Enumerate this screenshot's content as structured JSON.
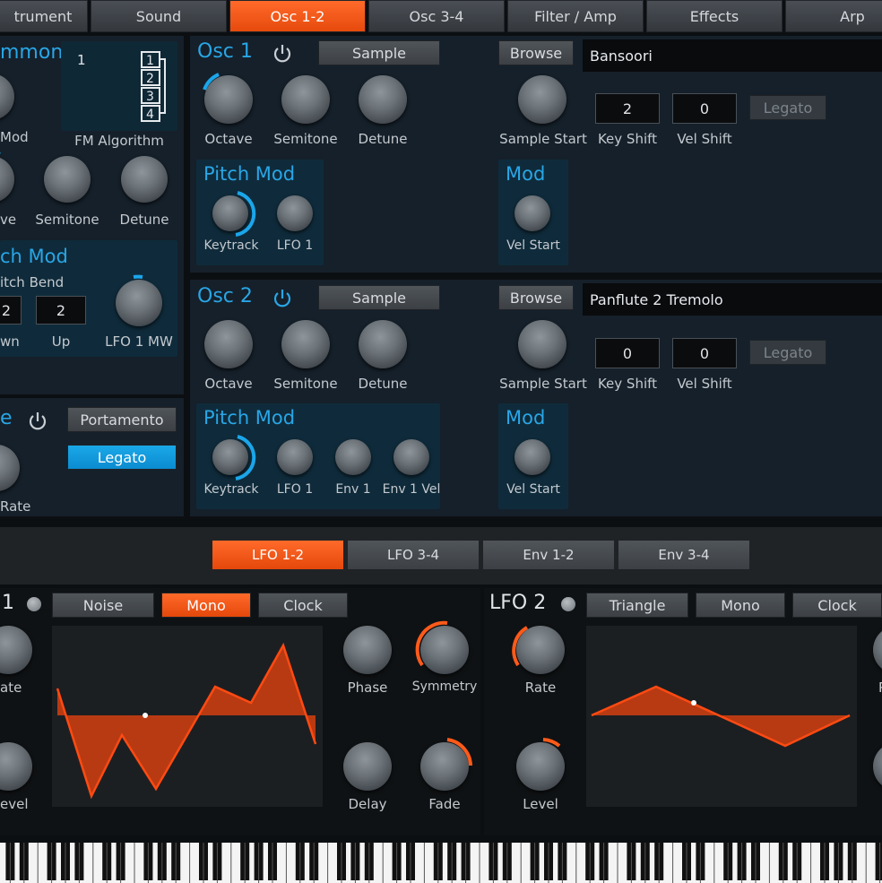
{
  "top_tabs": [
    {
      "label": "trument"
    },
    {
      "label": "Sound"
    },
    {
      "label": "Osc 1-2"
    },
    {
      "label": "Osc 3-4"
    },
    {
      "label": "Filter / Amp"
    },
    {
      "label": "Effects"
    },
    {
      "label": "Arp"
    }
  ],
  "common": {
    "title": "mmon",
    "algo_numbers": [
      "1",
      "2",
      "3",
      "4"
    ],
    "algo_selected": "1",
    "fm_algorithm": "FM Algorithm",
    "mod": "Mod",
    "octave": "ve",
    "semitone": "Semitone",
    "detune": "Detune",
    "pitch_mod": "ch Mod",
    "pitch_bend": "itch Bend",
    "down_value": "2",
    "up_value": "2",
    "down": "wn",
    "up": "Up",
    "lfo1mw": "LFO 1 MW"
  },
  "glide": {
    "title": "e",
    "portamento": "Portamento",
    "legato": "Legato",
    "rate": "Rate"
  },
  "osc1": {
    "title": "Osc 1",
    "sample": "Sample",
    "octave": "Octave",
    "semitone": "Semitone",
    "detune": "Detune",
    "pitch_mod": "Pitch Mod",
    "keytrack": "Keytrack",
    "lfo1": "LFO 1",
    "browse": "Browse",
    "sample_name": "Bansoori",
    "sample_start": "Sample Start",
    "key_shift": "Key Shift",
    "vel_shift": "Vel Shift",
    "key_shift_value": "2",
    "vel_shift_value": "0",
    "legato": "Legato",
    "mod": "Mod",
    "vel_start": "Vel Start"
  },
  "osc2": {
    "title": "Osc 2",
    "sample": "Sample",
    "octave": "Octave",
    "semitone": "Semitone",
    "detune": "Detune",
    "pitch_mod": "Pitch Mod",
    "keytrack": "Keytrack",
    "lfo1": "LFO 1",
    "env1": "Env 1",
    "env1vel": "Env 1 Vel",
    "browse": "Browse",
    "sample_name": "Panflute 2 Tremolo",
    "sample_start": "Sample Start",
    "key_shift": "Key Shift",
    "vel_shift": "Vel Shift",
    "key_shift_value": "0",
    "vel_shift_value": "0",
    "legato": "Legato",
    "mod": "Mod",
    "vel_start": "Vel Start"
  },
  "bottom_tabs": [
    {
      "label": "LFO 1-2"
    },
    {
      "label": "LFO 3-4"
    },
    {
      "label": "Env 1-2"
    },
    {
      "label": "Env 3-4"
    }
  ],
  "lfo1": {
    "title": "1",
    "wave": "Noise",
    "mono": "Mono",
    "clock": "Clock",
    "rate": "ate",
    "level": "evel",
    "phase": "Phase",
    "symmetry": "Symmetry",
    "delay": "Delay",
    "fade": "Fade"
  },
  "lfo2": {
    "title": "LFO 2",
    "wave": "Triangle",
    "mono": "Mono",
    "clock": "Clock",
    "rate": "Rate",
    "level": "Level",
    "right_cut": "P"
  },
  "colors": {
    "accent_orange": "#ff5a1a",
    "accent_blue": "#29a6e6",
    "panel": "#15202a",
    "subpanel": "#0f2b3b"
  }
}
